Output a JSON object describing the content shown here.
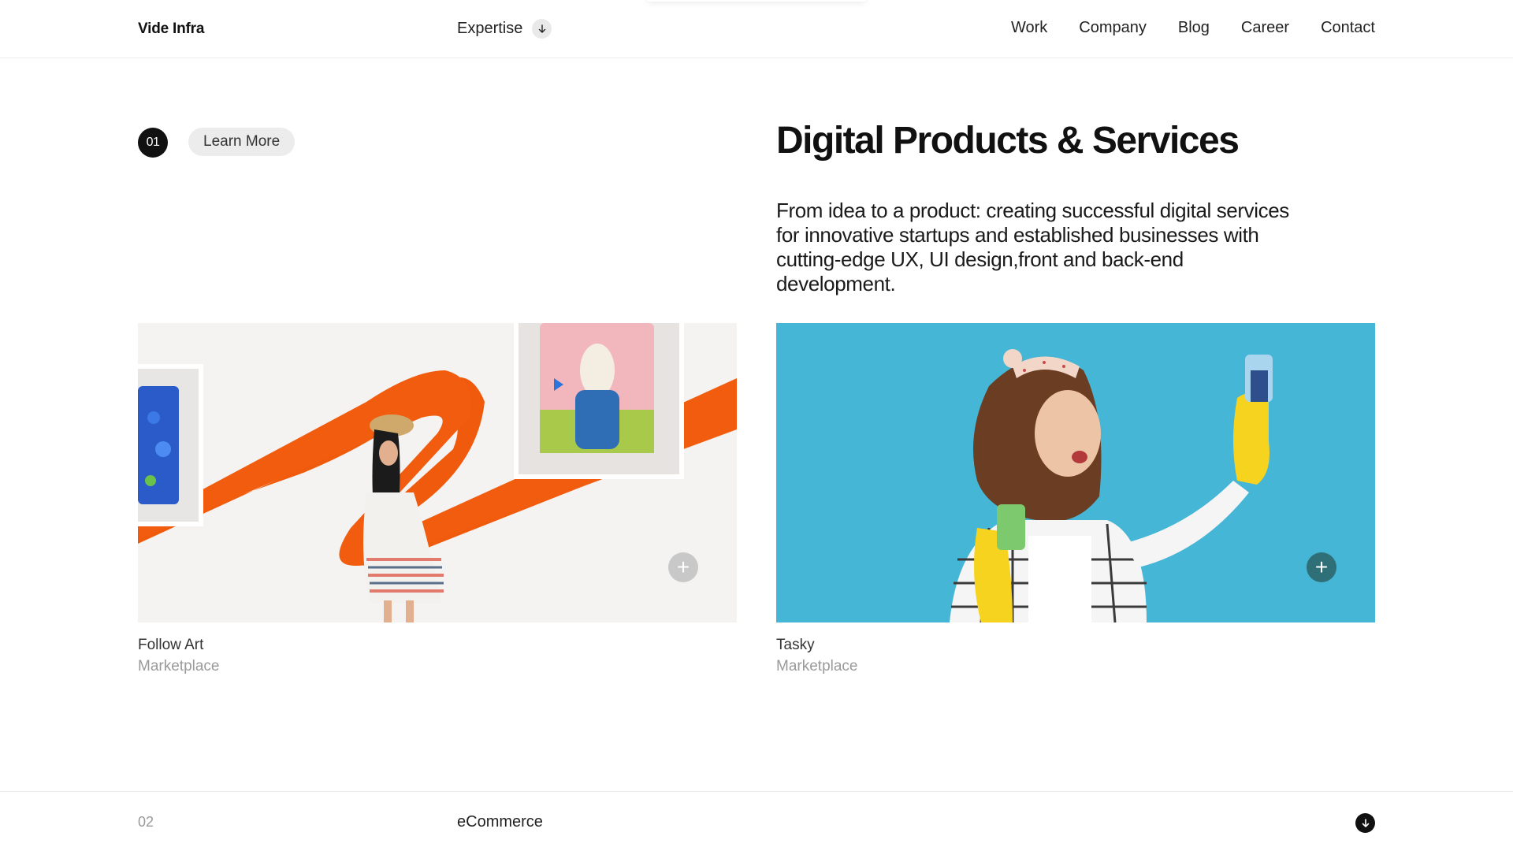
{
  "header": {
    "brand": "Vide Infra",
    "expertise_label": "Expertise",
    "nav": [
      "Work",
      "Company",
      "Blog",
      "Career",
      "Contact"
    ]
  },
  "section": {
    "number": "01",
    "learn_more": "Learn More",
    "title": "Digital Products & Services",
    "description": "From idea to a product: creating successful digital services for innovative startups and established businesses with cutting-edge UX, UI design,front and back-end development."
  },
  "cards": [
    {
      "title": "Follow Art",
      "subtitle": "Marketplace",
      "image_icon": "art-gallery-image",
      "accent": "#f05a0c"
    },
    {
      "title": "Tasky",
      "subtitle": "Marketplace",
      "image_icon": "cleaning-woman-image",
      "accent": "#43b5d6"
    }
  ],
  "next_section": {
    "number": "02",
    "label": "eCommerce"
  },
  "colors": {
    "text": "#1a1a1a",
    "muted": "#9a9a9a",
    "pill_bg": "#ececec",
    "dark": "#111111"
  }
}
